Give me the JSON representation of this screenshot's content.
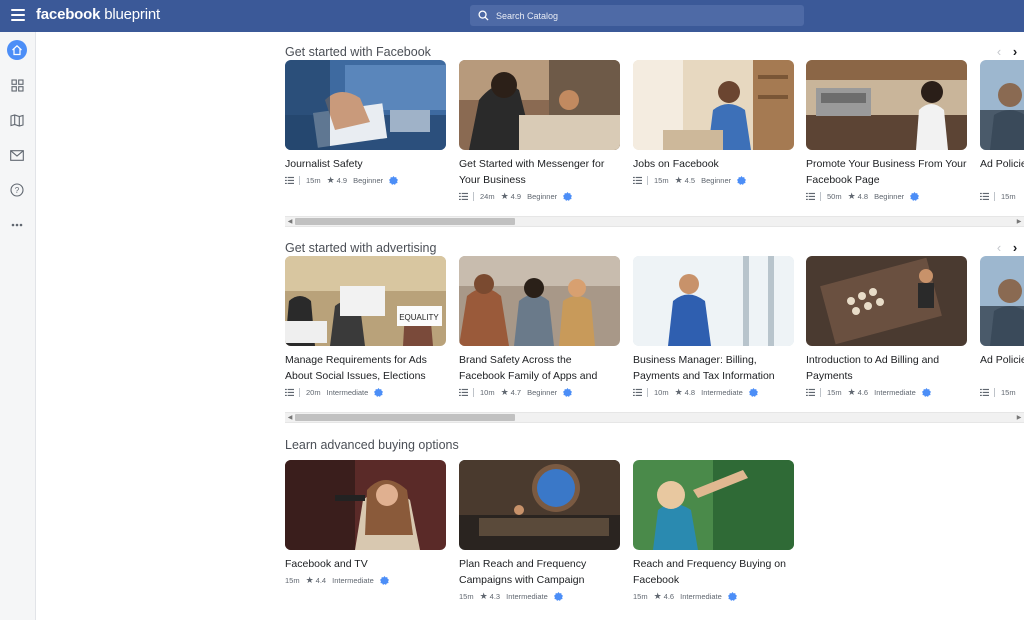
{
  "header": {
    "brand_bold": "facebook",
    "brand_light": "blueprint",
    "search_placeholder": "Search Catalog"
  },
  "sidebar": {
    "items": [
      "home-icon",
      "grid-icon",
      "map-icon",
      "mail-icon",
      "help-icon",
      "more-icon"
    ]
  },
  "sections": [
    {
      "title": "Get started with Facebook",
      "cards": [
        {
          "title": "Journalist Safety",
          "duration": "15m",
          "rating": "4.9",
          "level": "Beginner"
        },
        {
          "title": "Get Started with Messenger for Your Business",
          "duration": "24m",
          "rating": "4.9",
          "level": "Beginner"
        },
        {
          "title": "Jobs on Facebook",
          "duration": "15m",
          "rating": "4.5",
          "level": "Beginner"
        },
        {
          "title": "Promote Your Business From Your Facebook Page",
          "duration": "50m",
          "rating": "4.8",
          "level": "Beginner"
        },
        {
          "title": "Ad Policies and Targeting",
          "duration": "15m",
          "rating": "",
          "level": ""
        }
      ]
    },
    {
      "title": "Get started with advertising",
      "cards": [
        {
          "title": "Manage Requirements for Ads About Social Issues, Elections or…",
          "duration": "20m",
          "rating": "",
          "level": "Intermediate"
        },
        {
          "title": "Brand Safety Across the Facebook Family of Apps and Services",
          "duration": "10m",
          "rating": "4.7",
          "level": "Beginner"
        },
        {
          "title": "Business Manager: Billing, Payments and Tax Information",
          "duration": "10m",
          "rating": "4.8",
          "level": "Intermediate"
        },
        {
          "title": "Introduction to Ad Billing and Payments",
          "duration": "15m",
          "rating": "4.6",
          "level": "Intermediate"
        },
        {
          "title": "Ad Policies and Targeting",
          "duration": "15m",
          "rating": "",
          "level": ""
        }
      ]
    },
    {
      "title": "Learn advanced buying options",
      "cards": [
        {
          "title": "Facebook and TV",
          "duration": "15m",
          "rating": "4.4",
          "level": "Intermediate"
        },
        {
          "title": "Plan Reach and Frequency Campaigns with Campaign Planner",
          "duration": "15m",
          "rating": "4.3",
          "level": "Intermediate"
        },
        {
          "title": "Reach and Frequency Buying on Facebook",
          "duration": "15m",
          "rating": "4.6",
          "level": "Intermediate"
        }
      ]
    }
  ],
  "colors": {
    "header_bg": "#3b5998",
    "accent": "#4c8ef7",
    "badge": "#4c8ef7"
  }
}
